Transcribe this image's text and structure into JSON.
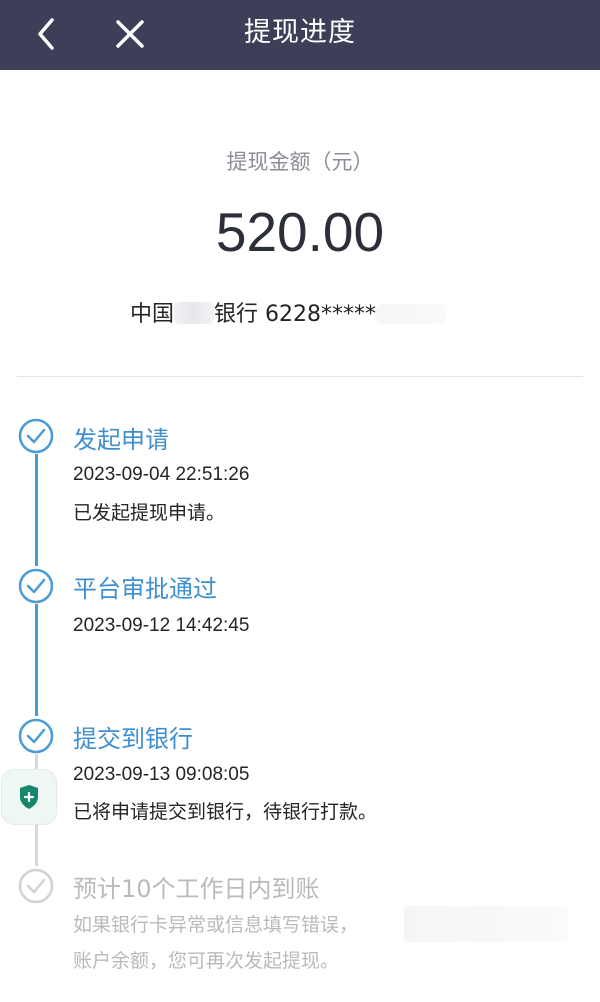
{
  "header": {
    "title": "提现进度",
    "back_icon": "chevron-left-icon",
    "close_icon": "close-icon",
    "background": "#3c3f57"
  },
  "withdrawal": {
    "amount_label": "提现金额（元）",
    "amount": "520.00",
    "bank_prefix": "中国",
    "bank_suffix": "银行 6228*****"
  },
  "accent_color": "#4a9bd6",
  "steps": [
    {
      "title": "发起申请",
      "time": "2023-09-04 22:51:26",
      "desc": "已发起提现申请。",
      "status": "done"
    },
    {
      "title": "平台审批通过",
      "time": "2023-09-12 14:42:45",
      "desc": "",
      "status": "done"
    },
    {
      "title": "提交到银行",
      "time": "2023-09-13 09:08:05",
      "desc": "已将申请提交到银行，待银行打款。",
      "status": "done"
    },
    {
      "title": "预计10个工作日内到账",
      "time": "",
      "desc_line1": "如果银行卡异常或信息填写错误，",
      "desc_line2": "账户余额，您可再次发起提现。",
      "status": "pending"
    }
  ]
}
